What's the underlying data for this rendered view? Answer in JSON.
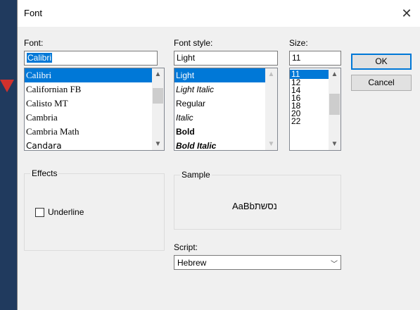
{
  "window": {
    "title": "Font",
    "close_glyph": "✕"
  },
  "font": {
    "label": "Font:",
    "value": "Calibri",
    "items": [
      "Calibri",
      "Californian FB",
      "Calisto MT",
      "Cambria",
      "Cambria Math",
      "Candara"
    ],
    "selected_index": 0
  },
  "style": {
    "label": "Font style:",
    "value": "Light",
    "items": [
      "Light",
      "Light Italic",
      "Regular",
      "Italic",
      "Bold",
      "Bold Italic"
    ],
    "selected_index": 0
  },
  "size": {
    "label": "Size:",
    "value": "11",
    "items": [
      "11",
      "12",
      "14",
      "16",
      "18",
      "20",
      "22"
    ],
    "selected_index": 0
  },
  "buttons": {
    "ok": "OK",
    "cancel": "Cancel"
  },
  "effects": {
    "title": "Effects",
    "underline_label": "Underline",
    "underline_checked": false
  },
  "sample": {
    "title": "Sample",
    "text": "AaBbנסשת"
  },
  "script": {
    "label": "Script:",
    "value": "Hebrew"
  },
  "icons": {
    "scroll_up": "▲",
    "scroll_down": "▼",
    "dropdown": "﹀"
  },
  "colors": {
    "selection": "#0078d7",
    "default_button_border": "#0078d7",
    "annotation_arrow": "#d0312d"
  }
}
